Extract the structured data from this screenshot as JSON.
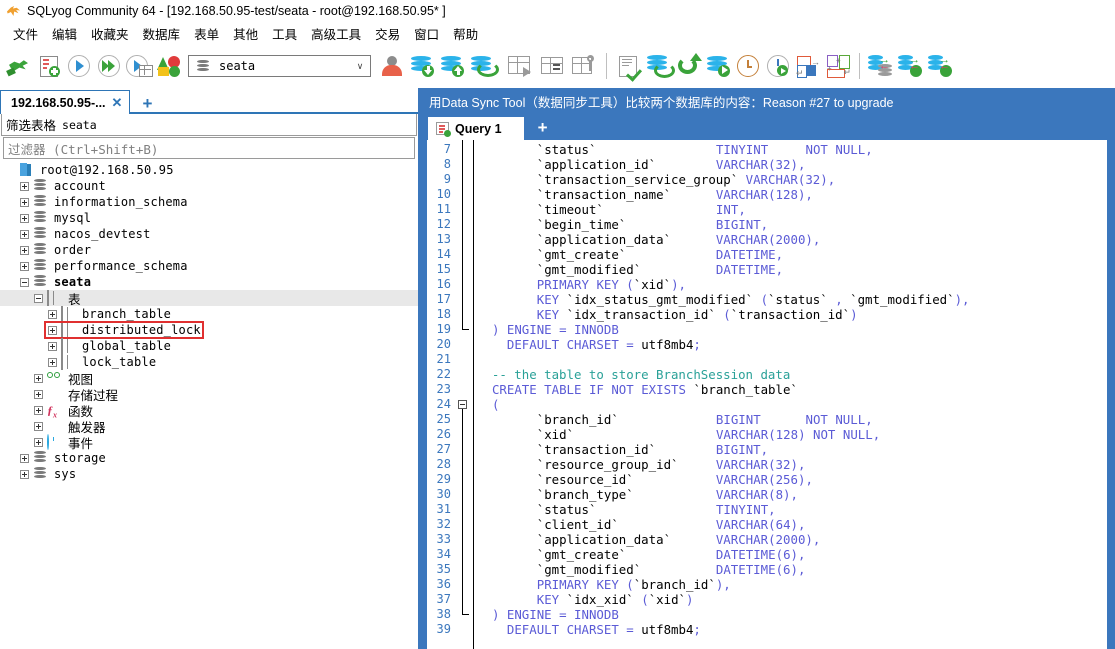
{
  "window": {
    "title": "SQLyog Community 64 - [192.168.50.95-test/seata - root@192.168.50.95* ]",
    "app_icon": "dolphin-icon"
  },
  "menu": {
    "items": [
      {
        "label": "文件",
        "name": "menu-file"
      },
      {
        "label": "编辑",
        "name": "menu-edit"
      },
      {
        "label": "收藏夹",
        "name": "menu-favorites"
      },
      {
        "label": "数据库",
        "name": "menu-database"
      },
      {
        "label": "表单",
        "name": "menu-form"
      },
      {
        "label": "其他",
        "name": "menu-other"
      },
      {
        "label": "工具",
        "name": "menu-tools"
      },
      {
        "label": "高级工具",
        "name": "menu-advanced-tools"
      },
      {
        "label": "交易",
        "name": "menu-transaction"
      },
      {
        "label": "窗口",
        "name": "menu-window"
      },
      {
        "label": "帮助",
        "name": "menu-help"
      }
    ]
  },
  "toolbar": {
    "db_selector": {
      "value": "seata",
      "icon": "database-icon",
      "caret": "∨"
    },
    "icons": [
      "new-connection-icon",
      "new-query-tab-icon",
      "execute-query-icon",
      "execute-all-queries-icon",
      "execute-query-new-tab-icon",
      "schema-designer-icon"
    ],
    "icons_right": [
      "user-manager-icon",
      "backup-database-icon",
      "restore-database-icon",
      "sync-database-icon",
      "table-export-icon",
      "table-diagnostics-icon",
      "table-key-icon",
      "query-builder-icon",
      "refresh-data-icon",
      "refresh-icon",
      "copy-database-icon",
      "scheduled-job-icon",
      "run-job-icon",
      "split-layout-icon",
      "form-layout-icon",
      "data-sync-icon",
      "data-sync-ok-icon",
      "data-sync-alt-icon"
    ]
  },
  "left_panel": {
    "tab": {
      "label": "192.168.50.95-...",
      "close": "✕"
    },
    "tab_add": "+",
    "filter_header": {
      "label": "筛选表格",
      "value": "seata"
    },
    "filter_input": {
      "placeholder_cn": "过滤器",
      "placeholder_key": " (Ctrl+Shift+B)",
      "value": ""
    },
    "tree": [
      {
        "label": "root@192.168.50.95",
        "icon": "server-icon",
        "indent": 0,
        "expander": "none",
        "bold": false,
        "mono": true
      },
      {
        "label": "account",
        "icon": "database-icon",
        "indent": 1,
        "expander": "plus",
        "bold": false,
        "mono": true
      },
      {
        "label": "information_schema",
        "icon": "database-icon",
        "indent": 1,
        "expander": "plus",
        "bold": false,
        "mono": true
      },
      {
        "label": "mysql",
        "icon": "database-icon",
        "indent": 1,
        "expander": "plus",
        "bold": false,
        "mono": true
      },
      {
        "label": "nacos_devtest",
        "icon": "database-icon",
        "indent": 1,
        "expander": "plus",
        "bold": false,
        "mono": true
      },
      {
        "label": "order",
        "icon": "database-icon",
        "indent": 1,
        "expander": "plus",
        "bold": false,
        "mono": true
      },
      {
        "label": "performance_schema",
        "icon": "database-icon",
        "indent": 1,
        "expander": "plus",
        "bold": false,
        "mono": true
      },
      {
        "label": "seata",
        "icon": "database-icon",
        "indent": 1,
        "expander": "minus",
        "bold": true,
        "mono": true
      },
      {
        "label": "表",
        "icon": "table-group-icon",
        "indent": 2,
        "expander": "minus",
        "bold": false,
        "mono": false,
        "selected": true
      },
      {
        "label": "branch_table",
        "icon": "table-icon",
        "indent": 3,
        "expander": "plus",
        "bold": false,
        "mono": true
      },
      {
        "label": "distributed_lock",
        "icon": "table-icon",
        "indent": 3,
        "expander": "plus",
        "bold": false,
        "mono": true,
        "highlight": true
      },
      {
        "label": "global_table",
        "icon": "table-icon",
        "indent": 3,
        "expander": "plus",
        "bold": false,
        "mono": true
      },
      {
        "label": "lock_table",
        "icon": "table-icon",
        "indent": 3,
        "expander": "plus",
        "bold": false,
        "mono": true
      },
      {
        "label": "视图",
        "icon": "view-icon",
        "indent": 2,
        "expander": "plus",
        "bold": false,
        "mono": false
      },
      {
        "label": "存储过程",
        "icon": "stored-procedure-icon",
        "indent": 2,
        "expander": "plus",
        "bold": false,
        "mono": false
      },
      {
        "label": "函数",
        "icon": "function-icon",
        "indent": 2,
        "expander": "plus",
        "bold": false,
        "mono": false
      },
      {
        "label": "触发器",
        "icon": "trigger-icon",
        "indent": 2,
        "expander": "plus",
        "bold": false,
        "mono": false
      },
      {
        "label": "事件",
        "icon": "event-icon",
        "indent": 2,
        "expander": "plus",
        "bold": false,
        "mono": false
      },
      {
        "label": "storage",
        "icon": "database-icon",
        "indent": 1,
        "expander": "plus",
        "bold": false,
        "mono": true
      },
      {
        "label": "sys",
        "icon": "database-icon",
        "indent": 1,
        "expander": "plus",
        "bold": false,
        "mono": true
      }
    ]
  },
  "right_panel": {
    "promo_banner": "用Data Sync Tool（数据同步工具）比较两个数据库的内容：Reason #27 to upgrade",
    "query_tab": {
      "label": "Query 1",
      "icon": "query-tab-icon"
    },
    "query_tab_add": "+",
    "editor": {
      "first_line_number": 7,
      "lines": [
        {
          "n": 7,
          "text": "        `status`                TINYINT     NOT NULL,"
        },
        {
          "n": 8,
          "text": "        `application_id`        VARCHAR(32),"
        },
        {
          "n": 9,
          "text": "        `transaction_service_group` VARCHAR(32),"
        },
        {
          "n": 10,
          "text": "        `transaction_name`      VARCHAR(128),"
        },
        {
          "n": 11,
          "text": "        `timeout`               INT,"
        },
        {
          "n": 12,
          "text": "        `begin_time`            BIGINT,"
        },
        {
          "n": 13,
          "text": "        `application_data`      VARCHAR(2000),"
        },
        {
          "n": 14,
          "text": "        `gmt_create`            DATETIME,"
        },
        {
          "n": 15,
          "text": "        `gmt_modified`          DATETIME,"
        },
        {
          "n": 16,
          "text": "        PRIMARY KEY (`xid`),"
        },
        {
          "n": 17,
          "text": "        KEY `idx_status_gmt_modified` (`status` , `gmt_modified`),"
        },
        {
          "n": 18,
          "text": "        KEY `idx_transaction_id` (`transaction_id`)"
        },
        {
          "n": 19,
          "text": "  ) ENGINE = INNODB"
        },
        {
          "n": 20,
          "text": "    DEFAULT CHARSET = utf8mb4;"
        },
        {
          "n": 21,
          "text": ""
        },
        {
          "n": 22,
          "text": "  -- the table to store BranchSession data"
        },
        {
          "n": 23,
          "text": "  CREATE TABLE IF NOT EXISTS `branch_table`"
        },
        {
          "n": 24,
          "text": "  ("
        },
        {
          "n": 25,
          "text": "        `branch_id`             BIGINT      NOT NULL,"
        },
        {
          "n": 26,
          "text": "        `xid`                   VARCHAR(128) NOT NULL,"
        },
        {
          "n": 27,
          "text": "        `transaction_id`        BIGINT,"
        },
        {
          "n": 28,
          "text": "        `resource_group_id`     VARCHAR(32),"
        },
        {
          "n": 29,
          "text": "        `resource_id`           VARCHAR(256),"
        },
        {
          "n": 30,
          "text": "        `branch_type`           VARCHAR(8),"
        },
        {
          "n": 31,
          "text": "        `status`                TINYINT,"
        },
        {
          "n": 32,
          "text": "        `client_id`             VARCHAR(64),"
        },
        {
          "n": 33,
          "text": "        `application_data`      VARCHAR(2000),"
        },
        {
          "n": 34,
          "text": "        `gmt_create`            DATETIME(6),"
        },
        {
          "n": 35,
          "text": "        `gmt_modified`          DATETIME(6),"
        },
        {
          "n": 36,
          "text": "        PRIMARY KEY (`branch_id`),"
        },
        {
          "n": 37,
          "text": "        KEY `idx_xid` (`xid`)"
        },
        {
          "n": 38,
          "text": "  ) ENGINE = INNODB"
        },
        {
          "n": 39,
          "text": "    DEFAULT CHARSET = utf8mb4;"
        }
      ]
    }
  },
  "colors": {
    "accent_blue": "#3b77bd",
    "keyword_blue": "#5b5bd6",
    "comment_teal": "#2aa198",
    "highlight_red": "#e03030",
    "gutter_blue": "#3b77bd"
  }
}
